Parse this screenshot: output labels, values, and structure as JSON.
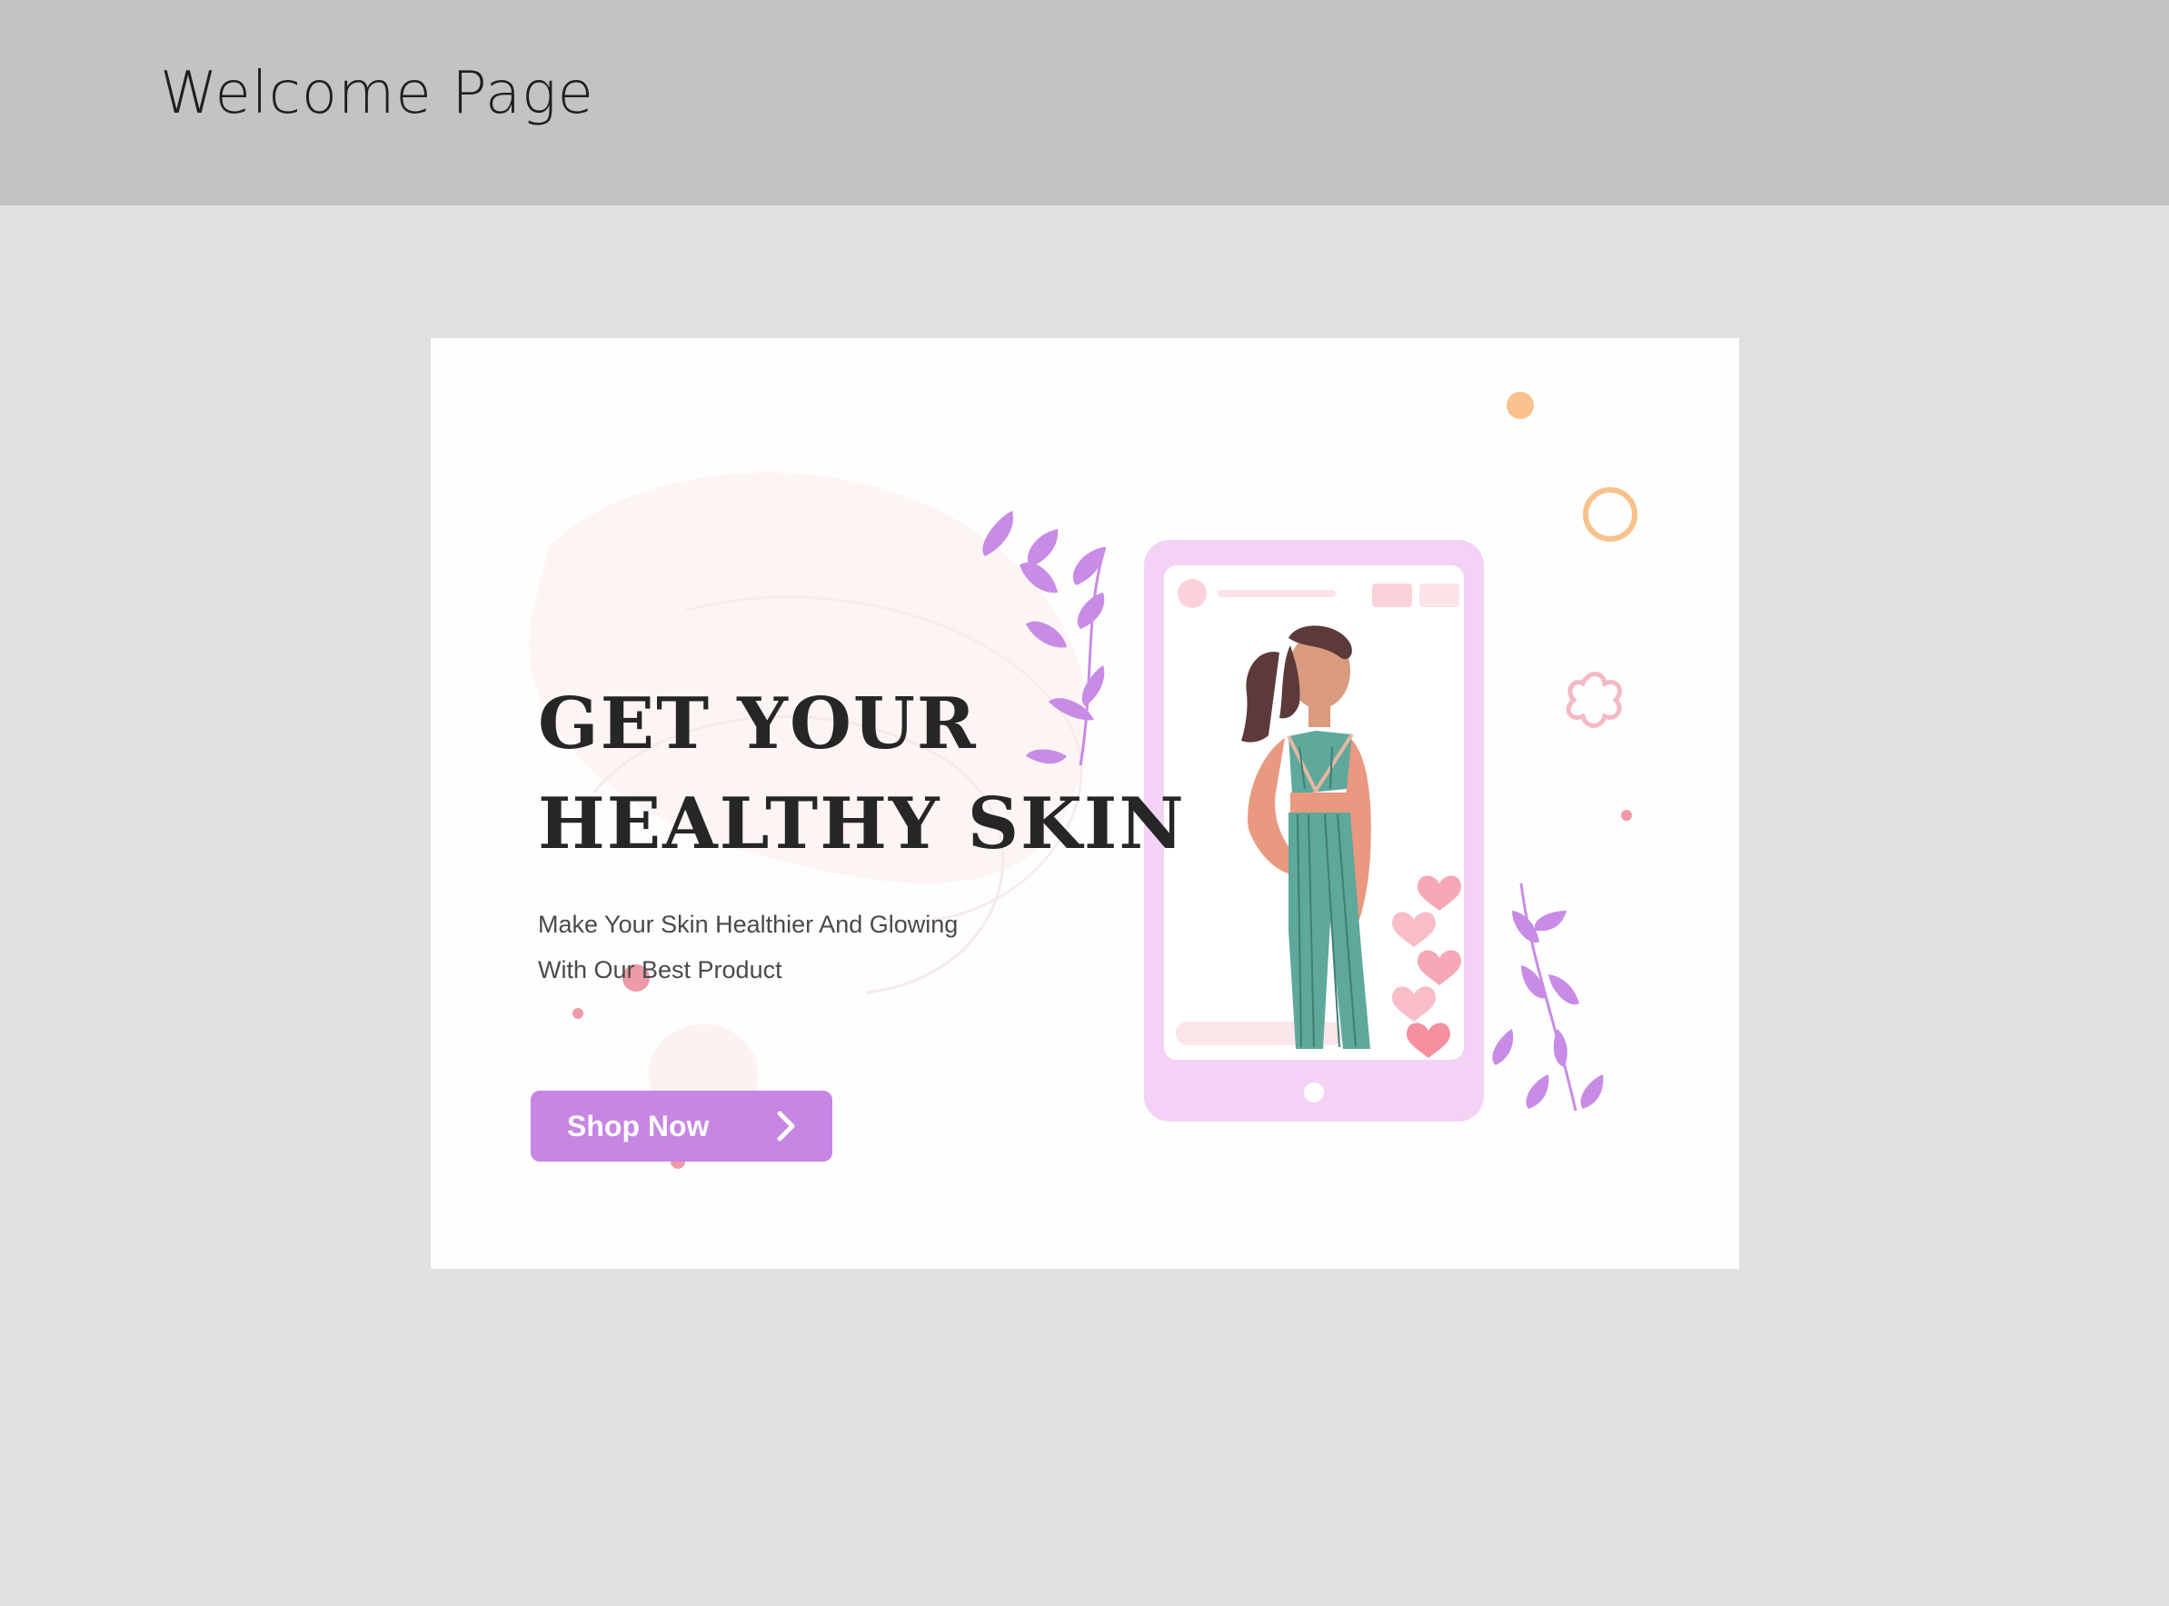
{
  "header": {
    "title": "Welcome Page"
  },
  "hero": {
    "headline_line1": "GET YOUR",
    "headline_line2": "HEALTHY SKIN",
    "subtext_line1": "Make Your Skin Healthier And Glowing",
    "subtext_line2": "With Our Best Product",
    "cta_label": "Shop Now"
  },
  "colors": {
    "topbar": "#c3c3c3",
    "page_background": "#e1e1e1",
    "card_background": "#fefefe",
    "accent_purple": "#c785e4",
    "phone_pink": "#f3d2f6",
    "heart_pink": "#f7a8b6",
    "outfit_teal": "#5fa89c",
    "orange_dot": "#f9c18b"
  },
  "icons": [
    "chevron-right-icon",
    "heart-icon",
    "leaf-icon",
    "circle-ring-icon",
    "flower-outline-icon"
  ]
}
